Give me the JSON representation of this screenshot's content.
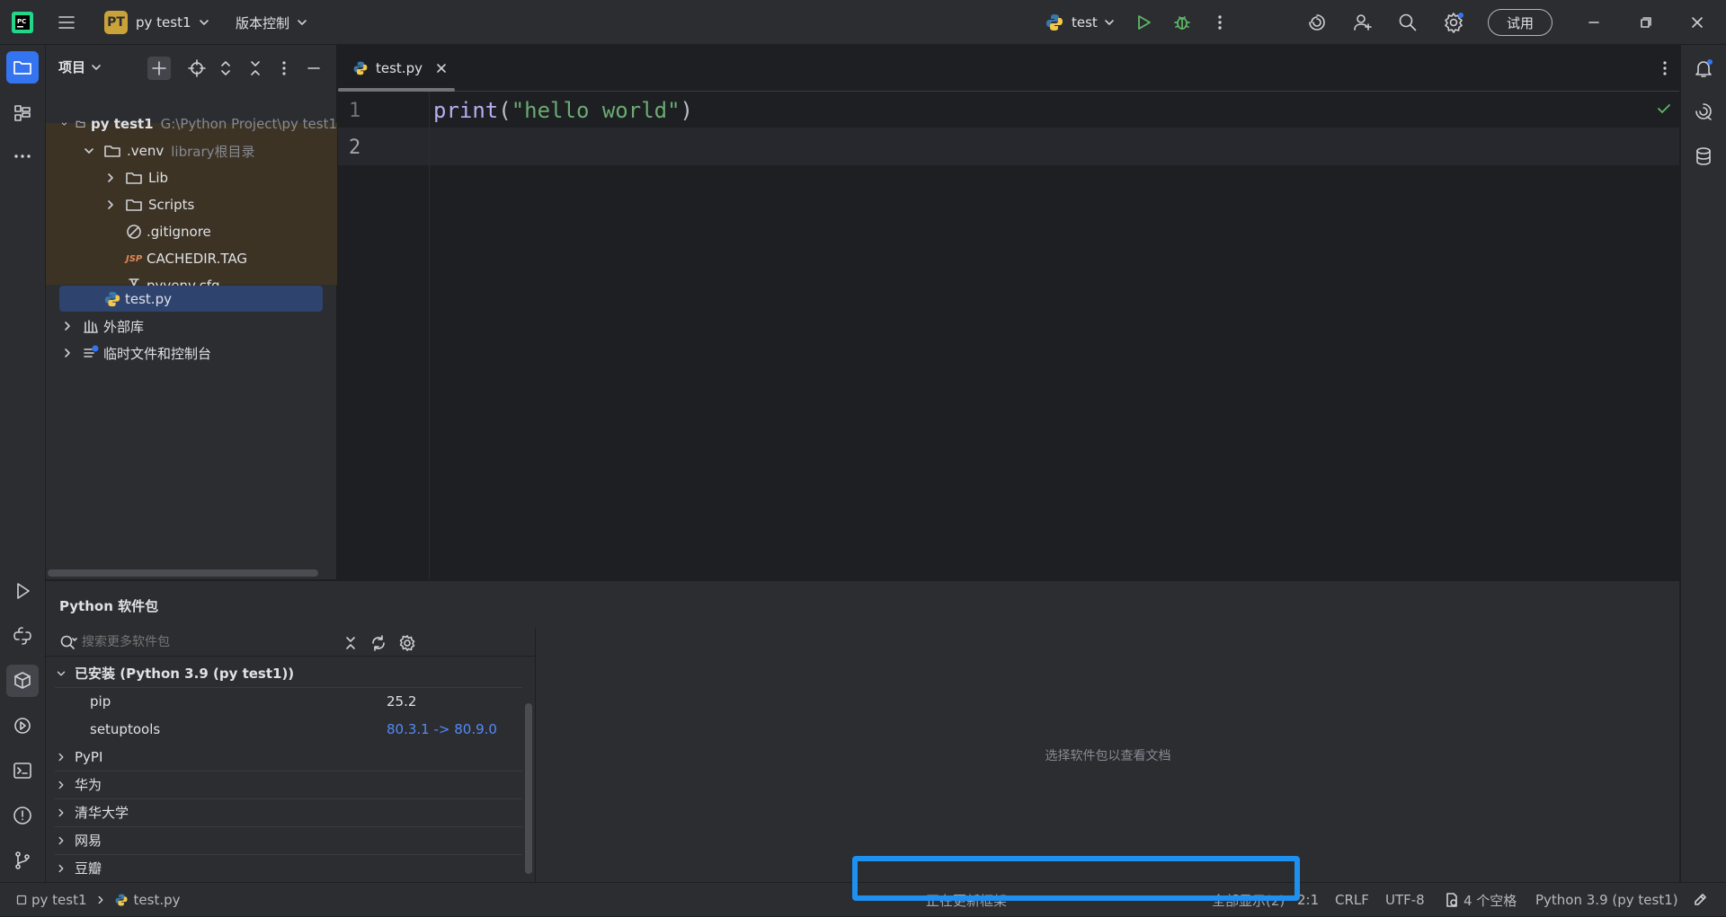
{
  "titlebar": {
    "project_badge": "PT",
    "project_name": "py test1",
    "vcs_label": "版本控制",
    "run_config": "test",
    "trial_label": "试用"
  },
  "project_panel": {
    "title": "项目",
    "tree": [
      {
        "label": "py test1",
        "hint": "G:\\Python Project\\py test1",
        "icon": "folder-icon",
        "expanded": true
      },
      {
        "label": ".venv",
        "hint": "library根目录",
        "icon": "folder-icon",
        "expanded": true
      },
      {
        "label": "Lib",
        "icon": "folder-icon",
        "expanded": false
      },
      {
        "label": "Scripts",
        "icon": "folder-icon",
        "expanded": false
      },
      {
        "label": ".gitignore",
        "icon": "ignore-file-icon"
      },
      {
        "label": "CACHEDIR.TAG",
        "icon": "jsp-file-icon",
        "icon_text": "JSP"
      },
      {
        "label": "pyvenv.cfg",
        "icon": "config-file-icon"
      },
      {
        "label": "test.py",
        "icon": "python-file-icon",
        "selected": true
      },
      {
        "label": "外部库",
        "icon": "library-icon",
        "expanded": false
      },
      {
        "label": "临时文件和控制台",
        "icon": "scratch-icon",
        "expanded": false
      }
    ]
  },
  "editor": {
    "tab_label": "test.py",
    "lines": [
      "1",
      "2"
    ],
    "code": {
      "fn": "print",
      "open": "(",
      "str": "\"hello world\"",
      "close": ")"
    }
  },
  "packages": {
    "title": "Python 软件包",
    "search_placeholder": "搜索更多软件包",
    "installed_group": "已安装 (Python 3.9 (py test1))",
    "installed": [
      {
        "name": "pip",
        "version": "25.2"
      },
      {
        "name": "setuptools",
        "version": "80.3.1 -> 80.9.0"
      }
    ],
    "repos": [
      "PyPI",
      "华为",
      "清华大学",
      "网易",
      "豆瓣"
    ],
    "doc_placeholder": "选择软件包以查看文档"
  },
  "statusbar": {
    "breadcrumb_project": "py test1",
    "breadcrumb_file": "test.py",
    "progress_text": "正在更新框架",
    "show_all": "全部显示(2)",
    "position": "2:1",
    "line_sep": "CRLF",
    "encoding": "UTF-8",
    "indent": "4 个空格",
    "interpreter": "Python 3.9 (py test1)"
  },
  "colors": {
    "accent": "#3574f0",
    "highlight_box": "#1e90f0",
    "venv_bg": "#3d3325",
    "selected_row": "#2e436e",
    "string": "#6aab73",
    "link_version": "#548af7"
  }
}
